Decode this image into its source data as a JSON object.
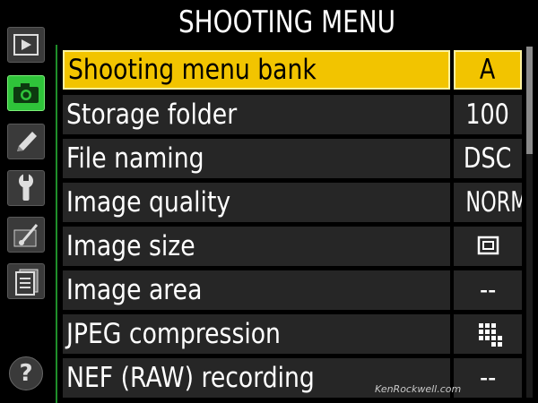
{
  "header": {
    "title": "SHOOTING MENU"
  },
  "sidebar": {
    "items": [
      {
        "icon": "playback-icon",
        "active": false
      },
      {
        "icon": "camera-icon",
        "active": true
      },
      {
        "icon": "pencil-icon",
        "active": false
      },
      {
        "icon": "wrench-icon",
        "active": false
      },
      {
        "icon": "retouch-brush-icon",
        "active": false
      },
      {
        "icon": "my-menu-icon",
        "active": false
      }
    ],
    "help": "?"
  },
  "menu": {
    "rows": [
      {
        "label": "Shooting menu bank",
        "value": "A",
        "selected": true
      },
      {
        "label": "Storage folder",
        "value": "100"
      },
      {
        "label": "File naming",
        "value": "DSC"
      },
      {
        "label": "Image quality",
        "value": "NORM"
      },
      {
        "label": "Image size",
        "value_icon": "image-size-large-icon"
      },
      {
        "label": "Image area",
        "value": "--"
      },
      {
        "label": "JPEG compression",
        "value_icon": "jpeg-compression-icon"
      },
      {
        "label": "NEF (RAW) recording",
        "value": "--"
      }
    ]
  },
  "watermark": "KenRockwell.com",
  "colors": {
    "selected": "#f2c400",
    "active_tab": "#2fc43a",
    "row_bg": "#262626"
  }
}
